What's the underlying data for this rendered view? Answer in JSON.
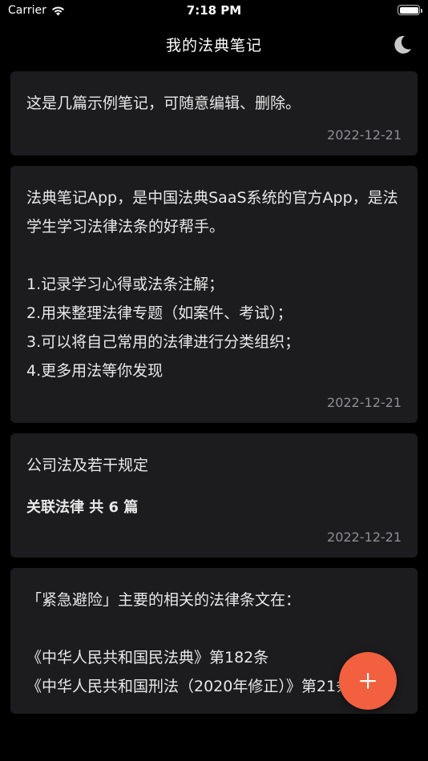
{
  "status_bar": {
    "carrier": "Carrier",
    "time": "7:18 PM"
  },
  "nav": {
    "title": "我的法典笔记",
    "theme_icon": "moon-icon"
  },
  "notes": [
    {
      "text": "这是几篇示例笔记，可随意编辑、删除。",
      "date": "2022-12-21"
    },
    {
      "text": "法典笔记App，是中国法典SaaS系统的官方App，是法学生学习法律法条的好帮手。\n\n1.记录学习心得或法条注解；\n2.用来整理法律专题（如案件、考试）；\n3.可以将自己常用的法律进行分类组织；\n4.更多用法等你发现",
      "date": "2022-12-21"
    },
    {
      "text": "公司法及若干规定",
      "related": "关联法律 共 6 篇",
      "date": "2022-12-21"
    },
    {
      "text": "「紧急避险」主要的相关的法律条文在：\n\n《中华人民共和国民法典》第182条\n《中华人民共和国刑法（2020年修正）》第21条"
    }
  ],
  "fab": {
    "icon": "plus-icon",
    "color": "#f2603f"
  },
  "colors": {
    "background": "#000000",
    "card": "#1c1c1e",
    "accent": "#f2603f",
    "date_text": "#8e8e93"
  }
}
